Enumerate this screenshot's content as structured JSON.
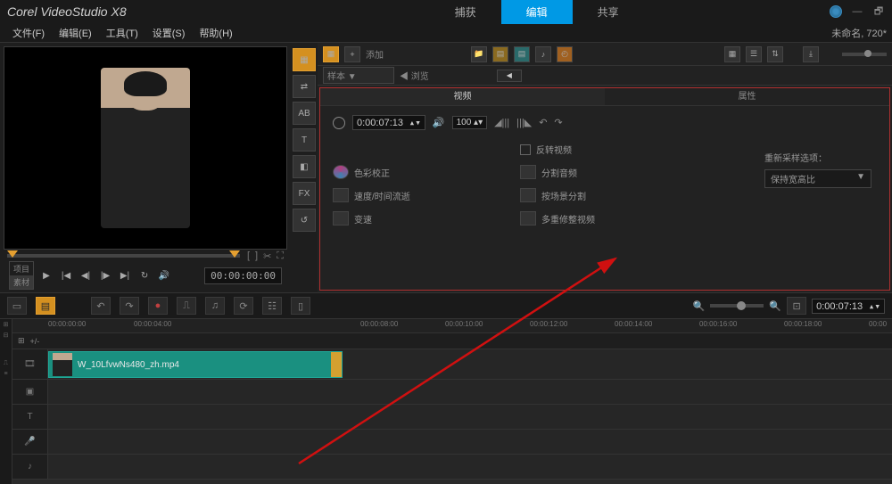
{
  "app_title": "Corel VideoStudio X8",
  "main_tabs": [
    "捕获",
    "编辑",
    "共享"
  ],
  "menubar": [
    "文件(F)",
    "编辑(E)",
    "工具(T)",
    "设置(S)",
    "帮助(H)"
  ],
  "project_name": "未命名, 720*",
  "preview": {
    "mode_tabs": [
      "项目",
      "素材"
    ],
    "timecode": "00:00:00:00"
  },
  "library": {
    "add_label": "添加",
    "dropdown": "样本 ▼",
    "browse_label": "浏览"
  },
  "options": {
    "tabs": [
      "视频",
      "属性"
    ],
    "timecode": "0:00:07:13",
    "volume": "100",
    "items": {
      "reverse": "反转视频",
      "color": "色彩校正",
      "split_audio": "分割音频",
      "speed": "速度/时间流逝",
      "scene_split": "按场景分割",
      "strobe": "变速",
      "multi_trim": "多重修整视频"
    },
    "resample_label": "重新采样选项：",
    "resample_value": "保持宽高比"
  },
  "timeline": {
    "timecode": "0:00:07:13",
    "ruler": [
      "00:00:00:00",
      "00:00:04:00",
      "00:00:08:00",
      "00:00:10:00",
      "00:00:12:00",
      "00:00:14:00",
      "00:00:16:00",
      "00:00:18:00",
      "00:00"
    ],
    "clip_name": "W_10LfvwNs480_zh.mp4"
  }
}
